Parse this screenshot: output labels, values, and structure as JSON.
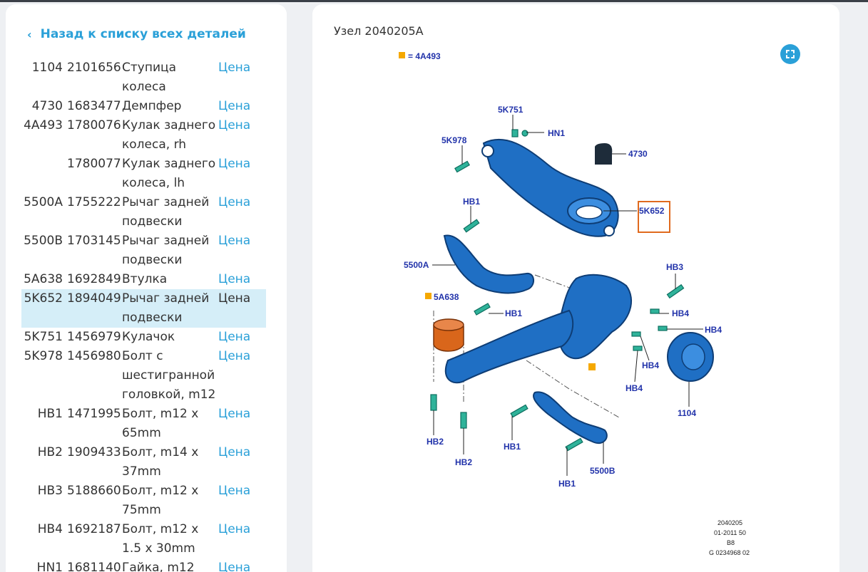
{
  "back_link": {
    "label": "Назад к списку всех деталей"
  },
  "parts": [
    {
      "code": "1104",
      "number": "2101656",
      "name": "Ступица колеса",
      "price": "Цена"
    },
    {
      "code": "4730",
      "number": "1683477",
      "name": "Демпфер",
      "price": "Цена"
    },
    {
      "code": "4A493",
      "number": "1780076",
      "name": "Кулак заднего колеса, rh",
      "price": "Цена"
    },
    {
      "code": "",
      "number": "1780077",
      "name": "Кулак заднего колеса, lh",
      "price": "Цена"
    },
    {
      "code": "5500A",
      "number": "1755222",
      "name": "Рычаг задней подвески",
      "price": "Цена"
    },
    {
      "code": "5500B",
      "number": "1703145",
      "name": "Рычаг задней подвески",
      "price": "Цена"
    },
    {
      "code": "5A638",
      "number": "1692849",
      "name": "Втулка",
      "price": "Цена"
    },
    {
      "code": "5K652",
      "number": "1894049",
      "name": "Рычаг задней подвески",
      "price": "Цена",
      "selected": true
    },
    {
      "code": "5K751",
      "number": "1456979",
      "name": "Кулачок",
      "price": "Цена"
    },
    {
      "code": "5K978",
      "number": "1456980",
      "name": "Болт с шестигранной головкой, m12",
      "price": "Цена"
    },
    {
      "code": "HB1",
      "number": "1471995",
      "name": "Болт, m12 x 65mm",
      "price": "Цена"
    },
    {
      "code": "HB2",
      "number": "1909433",
      "name": "Болт, m14 x 37mm",
      "price": "Цена"
    },
    {
      "code": "HB3",
      "number": "5188660",
      "name": "Болт, m12 x 75mm",
      "price": "Цена"
    },
    {
      "code": "HB4",
      "number": "1692187",
      "name": "Болт, m12 x 1.5 x 30mm",
      "price": "Цена"
    },
    {
      "code": "HN1",
      "number": "1681140",
      "name": "Гайка, m12",
      "price": "Цена"
    }
  ],
  "node": {
    "title": "Узел 2040205A"
  },
  "diagram": {
    "legend": "= 4A493",
    "labels": {
      "l_5k751": "5K751",
      "l_hn1": "HN1",
      "l_5k978": "5K978",
      "l_4730": "4730",
      "l_hb1a": "HB1",
      "l_5k652": "5K652",
      "l_5500a": "5500A",
      "l_hb3": "HB3",
      "l_5a638": "5A638",
      "l_hb1b": "HB1",
      "l_hb4a": "HB4",
      "l_hb4b": "HB4",
      "l_hb4c": "HB4",
      "l_hb4d": "HB4",
      "l_1104": "1104",
      "l_hb2a": "HB2",
      "l_hb2b": "HB2",
      "l_hb1c": "HB1",
      "l_hb1d": "HB1",
      "l_5500b": "5500B"
    },
    "footer": {
      "line1": "2040205",
      "line2": "01-2011 50",
      "line3": "B8",
      "line4": "G 0234968 02"
    }
  },
  "colors": {
    "accent": "#2aa0d8",
    "part_blue": "#1f6fc4",
    "bolt_green": "#2fb39a",
    "bushing": "#d9661b",
    "highlight_box": "#e06a1e",
    "legend_square": "#f5a800"
  },
  "icons": {
    "back": "chevron-left-icon",
    "expand": "expand-icon"
  }
}
